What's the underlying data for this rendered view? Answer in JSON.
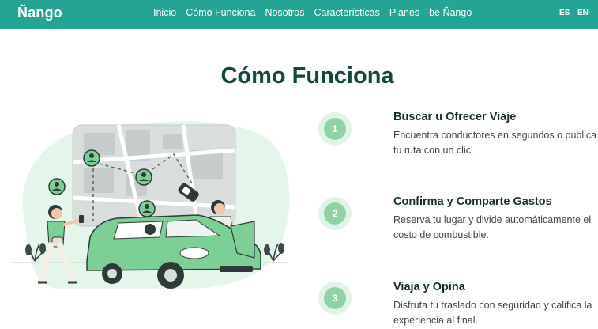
{
  "navbar": {
    "brand": "Ñango",
    "links": [
      "Inicio",
      "Cómo Funciona",
      "Nosotros",
      "Características",
      "Planes",
      "be Ñango"
    ],
    "languages": [
      "ES",
      "EN"
    ]
  },
  "section": {
    "title": "Cómo Funciona"
  },
  "steps": [
    {
      "number": "1",
      "title": "Buscar u Ofrecer Viaje",
      "description": "Encuentra conductores en segundos o publica tu ruta con un clic."
    },
    {
      "number": "2",
      "title": "Confirma y Comparte Gastos",
      "description": "Reserva tu lugar y divide automáticamente el costo de combustible."
    },
    {
      "number": "3",
      "title": "Viaja y Opina",
      "description": "Disfruta tu traslado con seguridad y califica la experiencia al final."
    }
  ],
  "colors": {
    "primary": "#23a495",
    "heading": "#14483f",
    "badge_outer": "#dff3e6",
    "badge_inner": "#8fd3a4",
    "car": "#7ccf95"
  },
  "illustration": {
    "icons": [
      "map-icon",
      "location-pin-icon",
      "car-icon",
      "person-icon",
      "plant-icon",
      "phone-icon"
    ]
  }
}
